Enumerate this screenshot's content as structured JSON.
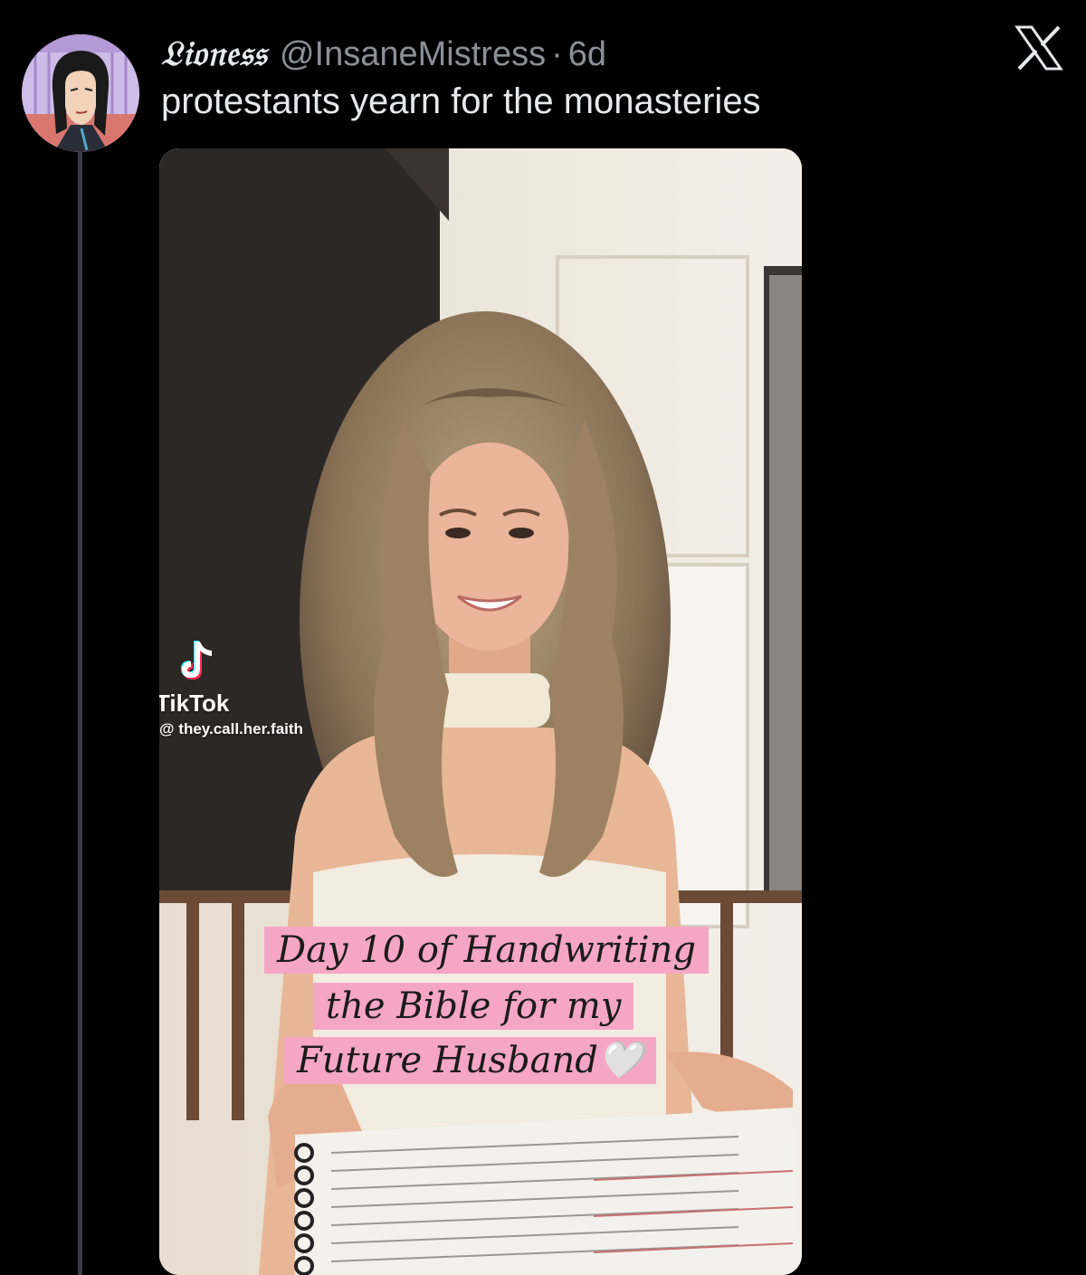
{
  "tweet": {
    "display_name": "𝔏𝔦𝔬𝔫𝔢𝔰𝔰",
    "handle": "@InsaneMistress",
    "separator": "·",
    "time_ago": "6d",
    "text": "protestants yearn for the monasteries"
  },
  "app": {
    "logo_icon": "x-logo-icon"
  },
  "media": {
    "watermark_brand": "TikTok",
    "watermark_user": "@ they.call.her.faith",
    "caption_lines": [
      "Day 10 of Handwriting",
      "the Bible for my",
      "Future Husband🤍"
    ]
  },
  "colors": {
    "background": "#000000",
    "text_primary": "#e7e9ea",
    "text_secondary": "#8b9096",
    "caption_bg": "#f5a6c4"
  }
}
